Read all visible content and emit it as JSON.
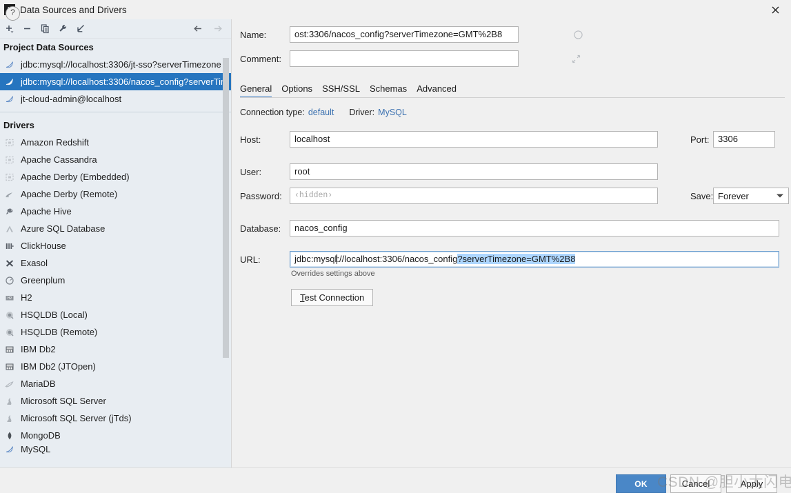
{
  "window": {
    "title": "Data Sources and Drivers",
    "app_icon_text": "IJ",
    "close_icon": "close-icon"
  },
  "left_panel": {
    "toolbar": {
      "add": "add-icon",
      "remove": "remove-icon",
      "copy": "copy-icon",
      "settings": "wrench-icon",
      "import": "import-icon",
      "back": "arrow-left-icon",
      "forward": "arrow-right-icon"
    },
    "project_sources_header": "Project Data Sources",
    "data_sources": [
      {
        "label": "jdbc:mysql://localhost:3306/jt-sso?serverTimezone",
        "icon": "mysql-icon",
        "selected": false
      },
      {
        "label": "jdbc:mysql://localhost:3306/nacos_config?serverTim",
        "icon": "mysql-icon",
        "selected": true
      },
      {
        "label": "jt-cloud-admin@localhost",
        "icon": "mysql-icon",
        "selected": false
      }
    ],
    "drivers_header": "Drivers",
    "drivers": [
      {
        "label": "Amazon Redshift",
        "icon": "redshift-icon"
      },
      {
        "label": "Apache Cassandra",
        "icon": "cassandra-icon"
      },
      {
        "label": "Apache Derby (Embedded)",
        "icon": "derby-icon"
      },
      {
        "label": "Apache Derby (Remote)",
        "icon": "derby-remote-icon"
      },
      {
        "label": "Apache Hive",
        "icon": "hive-icon"
      },
      {
        "label": "Azure SQL Database",
        "icon": "azure-icon"
      },
      {
        "label": "ClickHouse",
        "icon": "clickhouse-icon"
      },
      {
        "label": "Exasol",
        "icon": "exasol-icon"
      },
      {
        "label": "Greenplum",
        "icon": "greenplum-icon"
      },
      {
        "label": "H2",
        "icon": "h2-icon"
      },
      {
        "label": "HSQLDB (Local)",
        "icon": "hsqldb-icon"
      },
      {
        "label": "HSQLDB (Remote)",
        "icon": "hsqldb-icon"
      },
      {
        "label": "IBM Db2",
        "icon": "db2-icon"
      },
      {
        "label": "IBM Db2 (JTOpen)",
        "icon": "db2-icon"
      },
      {
        "label": "MariaDB",
        "icon": "mariadb-icon"
      },
      {
        "label": "Microsoft SQL Server",
        "icon": "mssql-icon"
      },
      {
        "label": "Microsoft SQL Server (jTds)",
        "icon": "mssql-icon"
      },
      {
        "label": "MongoDB",
        "icon": "mongodb-icon"
      },
      {
        "label": "MySQL",
        "icon": "mysql-icon"
      }
    ]
  },
  "form": {
    "name_label": "Name:",
    "name_value": "ost:3306/nacos_config?serverTimezone=GMT%2B8",
    "name_icon": "circle-toggle-icon",
    "comment_label": "Comment:",
    "comment_value": "",
    "comment_placeholder": "",
    "comment_icon": "expand-icon",
    "tabs": [
      {
        "label": "General",
        "active": true
      },
      {
        "label": "Options",
        "active": false
      },
      {
        "label": "SSH/SSL",
        "active": false
      },
      {
        "label": "Schemas",
        "active": false
      },
      {
        "label": "Advanced",
        "active": false
      }
    ],
    "connection_type_label": "Connection type:",
    "connection_type_value": "default",
    "driver_label": "Driver:",
    "driver_value": "MySQL",
    "host_label": "Host:",
    "host_value": "localhost",
    "port_label": "Port:",
    "port_value": "3306",
    "user_label": "User:",
    "user_value": "root",
    "password_label": "Password:",
    "password_placeholder": "‹hidden›",
    "save_label": "Save:",
    "save_value": "Forever",
    "database_label": "Database:",
    "database_value": "nacos_config",
    "url_label": "URL:",
    "url_prefix": "jdbc:mysql",
    "url_middle": "://localhost:3306/nacos_config",
    "url_selected": "?serverTimezone=GMT%2B8",
    "url_hint": "Overrides settings above",
    "test_connection_mnemonic": "T",
    "test_connection_rest": "est Connection"
  },
  "footer": {
    "help_label": "?",
    "ok_label": "OK",
    "cancel_label": "Cancel",
    "apply_mnemonic": "A",
    "apply_rest": "pply",
    "watermark": "CSDN @胆小太闪电"
  },
  "colors": {
    "accent_blue": "#2675bf",
    "ok_button": "#4a87c7",
    "link": "#3b71b0",
    "selection": "#add6ff",
    "panel_bg": "#e8edf2"
  }
}
